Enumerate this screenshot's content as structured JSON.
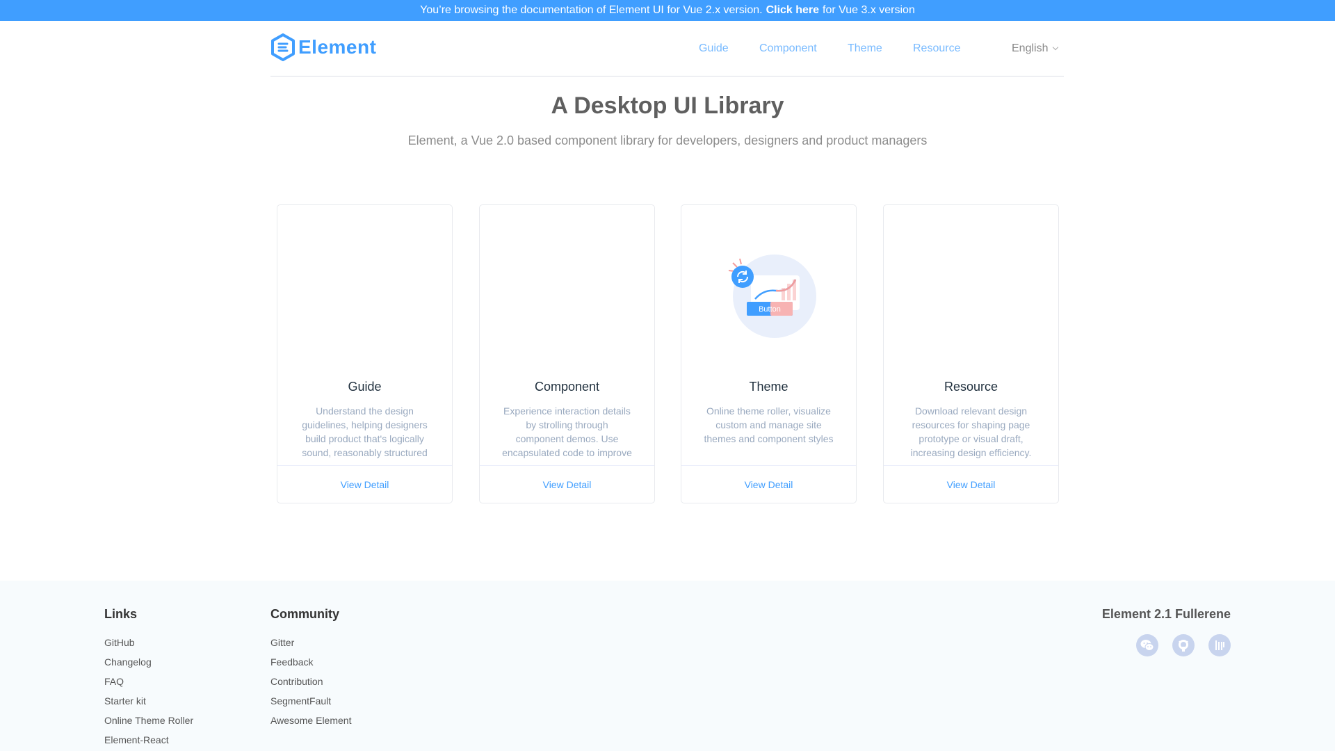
{
  "banner": {
    "before": "You’re browsing the documentation of Element UI for Vue 2.x version.",
    "link": "Click here",
    "after": "for Vue 3.x version"
  },
  "header": {
    "logo_text": "Element",
    "nav": [
      {
        "label": "Guide"
      },
      {
        "label": "Component"
      },
      {
        "label": "Theme"
      },
      {
        "label": "Resource"
      }
    ],
    "language": "English"
  },
  "hero": {
    "title": "A Desktop UI Library",
    "subtitle": "Element, a Vue 2.0 based component library for developers, designers and product managers"
  },
  "cards": [
    {
      "title": "Guide",
      "description": "Understand the design guidelines, helping designers build product that's logically sound, reasonably structured and easy to use.",
      "link": "View Detail"
    },
    {
      "title": "Component",
      "description": "Experience interaction details by strolling through component demos. Use encapsulated code to improve developing efficiency.",
      "link": "View Detail"
    },
    {
      "title": "Theme",
      "description": "Online theme roller, visualize custom and manage site themes and component styles",
      "link": "View Detail",
      "image_button_label": "Button"
    },
    {
      "title": "Resource",
      "description": "Download relevant design resources for shaping page prototype or visual draft, increasing design efficiency.",
      "link": "View Detail"
    }
  ],
  "footer": {
    "links": {
      "heading": "Links",
      "items": [
        "GitHub",
        "Changelog",
        "FAQ",
        "Starter kit",
        "Online Theme Roller",
        "Element-React"
      ]
    },
    "community": {
      "heading": "Community",
      "items": [
        "Gitter",
        "Feedback",
        "Contribution",
        "SegmentFault",
        "Awesome Element"
      ]
    },
    "release": "Element 2.1 Fullerene",
    "social_icons": [
      "wechat-icon",
      "github-icon",
      "gitter-icon"
    ]
  },
  "colors": {
    "primary": "#409eff",
    "footer_bg": "#f7fbfd",
    "social_icon_bg": "#c8d4ee"
  }
}
